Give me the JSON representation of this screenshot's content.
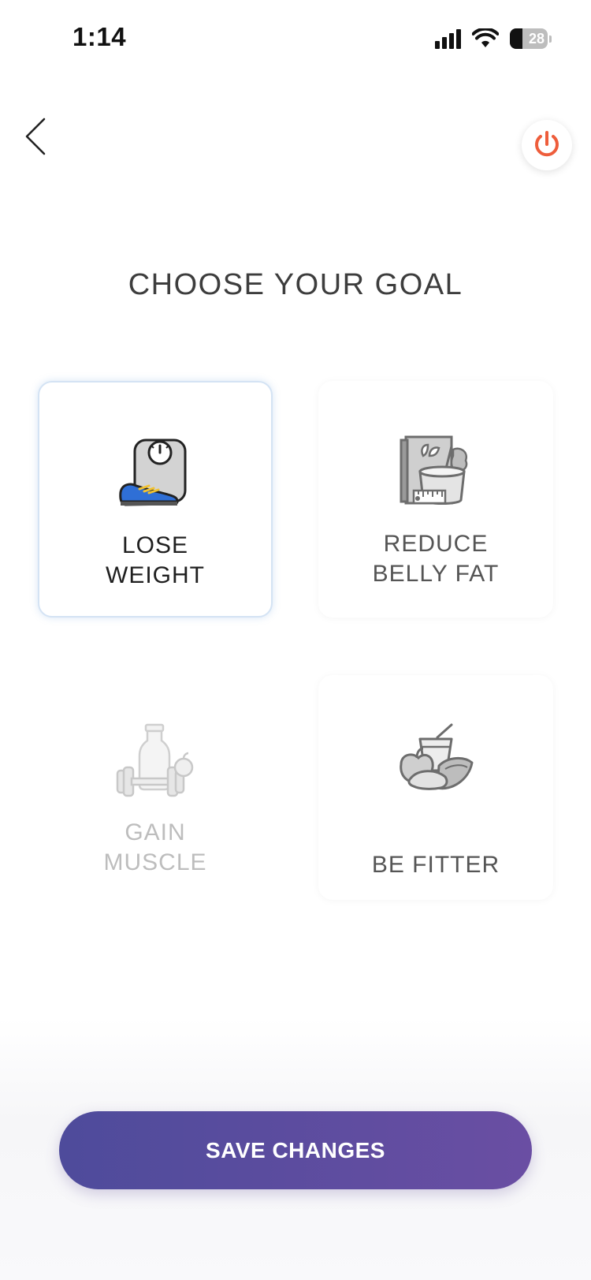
{
  "status_bar": {
    "time": "1:14",
    "battery_percent": "28"
  },
  "header": {
    "back_icon": "chevron-left-icon",
    "power_icon": "power-icon",
    "power_color": "#ee5d3b"
  },
  "title": "CHOOSE YOUR GOAL",
  "goals": [
    {
      "line1": "LOSE",
      "line2": "WEIGHT",
      "icon": "scale-shoe-icon",
      "state": "selected"
    },
    {
      "line1": "REDUCE",
      "line2": "BELLY FAT",
      "icon": "food-box-tape-icon",
      "state": "available"
    },
    {
      "line1": "GAIN",
      "line2": "MUSCLE",
      "icon": "dumbbell-bottle-icon",
      "state": "disabled"
    },
    {
      "line1": "",
      "line2": "BE FITTER",
      "icon": "fruit-smoothie-icon",
      "state": "available"
    }
  ],
  "save_button": {
    "label": "SAVE CHANGES"
  },
  "colors": {
    "accent_start": "#4e4b9b",
    "accent_end": "#6a4ea3",
    "selected_border": "#d4e3f4",
    "shoe_blue": "#2f6fd6"
  }
}
